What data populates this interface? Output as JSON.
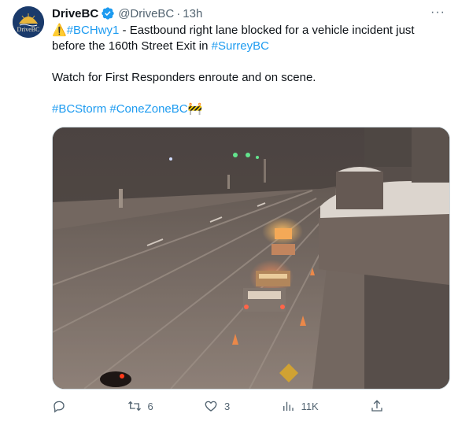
{
  "account": {
    "name": "DriveBC",
    "handle": "@DriveBC",
    "separator": "·",
    "time": "13h",
    "avatar_text": "DriveBC",
    "verified_icon": "verified-badge-icon"
  },
  "post": {
    "warning_emoji": "⚠️",
    "hashtag_hwy": "#BCHwy1",
    "line1_text": " - Eastbound right lane blocked for a vehicle incident just",
    "line2_text": "before the 160th Street Exit in ",
    "hashtag_surrey": "#SurreyBC",
    "line3_text": "Watch for First Responders enroute and on scene.",
    "hashtag_storm": "#BCStorm",
    "hashtag_conezone": "#ConeZoneBC",
    "construction_emoji": "🚧"
  },
  "actions": {
    "reply_count": "",
    "retweet_count": "6",
    "like_count": "3",
    "views_count": "11K",
    "share_count": ""
  },
  "colors": {
    "link": "#1d9bf0",
    "text": "#0f1419",
    "muted": "#536471",
    "avatar_bg": "#1a3a6b"
  }
}
